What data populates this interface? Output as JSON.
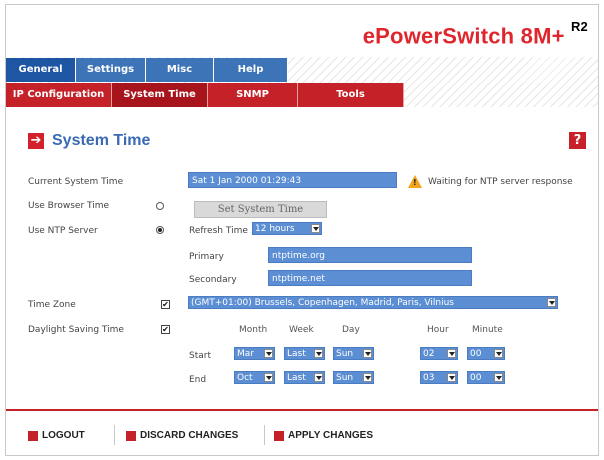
{
  "brand": {
    "name_part1": "ePower",
    "name_part2": "Switch",
    "model": "8M+",
    "revision": "R2"
  },
  "top_tabs": [
    {
      "label": "General",
      "active": true
    },
    {
      "label": "Settings",
      "active": false
    },
    {
      "label": "Misc",
      "active": false
    },
    {
      "label": "Help",
      "active": false
    }
  ],
  "sub_tabs": [
    {
      "label": "IP Configuration",
      "active": false
    },
    {
      "label": "System Time",
      "active": true
    },
    {
      "label": "SNMP",
      "active": false
    },
    {
      "label": "Tools",
      "active": false
    }
  ],
  "page": {
    "title": "System Time",
    "help_icon": "?"
  },
  "form": {
    "current_time_label": "Current System Time",
    "current_time_value": "Sat 1 Jan 2000 01:29:43",
    "warning_text": "Waiting for NTP server response",
    "browser_time_label": "Use Browser Time",
    "set_button": "Set System Time",
    "ntp_label": "Use NTP Server",
    "refresh_label": "Refresh Time",
    "refresh_value": "12 hours",
    "primary_label": "Primary",
    "primary_value": "ntptime.org",
    "secondary_label": "Secondary",
    "secondary_value": "ntptime.net",
    "timezone_label": "Time Zone",
    "timezone_value": "(GMT+01:00) Brussels, Copenhagen, Madrid, Paris, Vilnius",
    "dst_label": "Daylight Saving Time",
    "dst_headers": {
      "month": "Month",
      "week": "Week",
      "day": "Day",
      "hour": "Hour",
      "minute": "Minute"
    },
    "start": {
      "label": "Start",
      "month": "Mar",
      "week": "Last",
      "day": "Sun",
      "hour": "02",
      "minute": "00"
    },
    "end": {
      "label": "End",
      "month": "Oct",
      "week": "Last",
      "day": "Sun",
      "hour": "03",
      "minute": "00"
    }
  },
  "footer": {
    "logout": "LOGOUT",
    "discard": "DISCARD CHANGES",
    "apply": "APPLY CHANGES"
  },
  "colors": {
    "accent_red": "#c42128",
    "accent_blue": "#3d74b8",
    "field_blue": "#5b8ed3"
  }
}
